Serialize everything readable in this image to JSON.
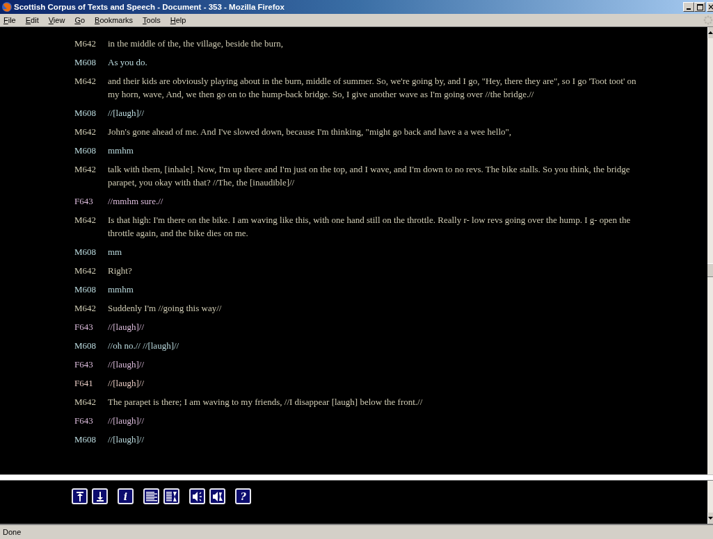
{
  "window": {
    "title": "Scottish Corpus of Texts and Speech - Document - 353 - Mozilla Firefox"
  },
  "menu": [
    "File",
    "Edit",
    "View",
    "Go",
    "Bookmarks",
    "Tools",
    "Help"
  ],
  "turns": [
    {
      "speaker": "M642",
      "color": "#d0ccb4",
      "text": "in the middle of the, the village, beside the burn,"
    },
    {
      "speaker": "M608",
      "color": "#bcdce0",
      "text": "As you do."
    },
    {
      "speaker": "M642",
      "color": "#d0ccb4",
      "text": "and their kids are obviously playing about in the burn, middle of summer. So, we're going by, and I go, \"Hey, there they are\", so I go 'Toot toot' on my horn, wave, And, we then go on to the hump-back bridge. So, I give another wave as I'm going over //the bridge.//"
    },
    {
      "speaker": "M608",
      "color": "#bcdce0",
      "text": "//[laugh]//"
    },
    {
      "speaker": "M642",
      "color": "#d0ccb4",
      "text": "John's gone ahead of me. And I've slowed down, because I'm thinking, \"might go back and have a a wee hello\","
    },
    {
      "speaker": "M608",
      "color": "#bcdce0",
      "text": "mmhm"
    },
    {
      "speaker": "M642",
      "color": "#d0ccb4",
      "text": "talk with them, [inhale]. Now, I'm up there and I'm just on the top, and I wave, and I'm down to no revs. The bike stalls. So you think, the bridge parapet, you okay with that? //The, the [inaudible]//"
    },
    {
      "speaker": "F643",
      "color": "#dcbcdc",
      "text": "//mmhm sure.//"
    },
    {
      "speaker": "M642",
      "color": "#d0ccb4",
      "text": "Is that high: I'm there on the bike. I am waving like this, with one hand still on the throttle. Really r- low revs going over the hump. I g- open the throttle again, and the bike dies on me."
    },
    {
      "speaker": "M608",
      "color": "#bcdce0",
      "text": "mm"
    },
    {
      "speaker": "M642",
      "color": "#d0ccb4",
      "text": "Right?"
    },
    {
      "speaker": "M608",
      "color": "#bcdce0",
      "text": "mmhm"
    },
    {
      "speaker": "M642",
      "color": "#d0ccb4",
      "text": "Suddenly I'm //going this way//"
    },
    {
      "speaker": "F643",
      "color": "#dcbcdc",
      "text": "//[laugh]//"
    },
    {
      "speaker": "M608",
      "color": "#bcdce0",
      "text": "//oh no.// //[laugh]//"
    },
    {
      "speaker": "F643",
      "color": "#dcbcdc",
      "text": "//[laugh]//"
    },
    {
      "speaker": "F641",
      "color": "#e4c8c0",
      "text": "//[laugh]//"
    },
    {
      "speaker": "M642",
      "color": "#d0ccb4",
      "text": "The parapet is there; I am waving to my friends, //I disappear [laugh] below the front.//"
    },
    {
      "speaker": "F643",
      "color": "#dcbcdc",
      "text": "//[laugh]//"
    },
    {
      "speaker": "M608",
      "color": "#bcdce0",
      "text": "//[laugh]//"
    }
  ],
  "toolbar": [
    [
      {
        "kind": "top"
      },
      {
        "kind": "bottom"
      }
    ],
    [
      {
        "kind": "glyph",
        "label": "i"
      }
    ],
    [
      {
        "kind": "lines"
      },
      {
        "kind": "scroll-text"
      }
    ],
    [
      {
        "kind": "audio"
      },
      {
        "kind": "audio-play"
      }
    ],
    [
      {
        "kind": "glyph",
        "label": "?"
      }
    ]
  ],
  "status_bar": {
    "text": "Done"
  }
}
